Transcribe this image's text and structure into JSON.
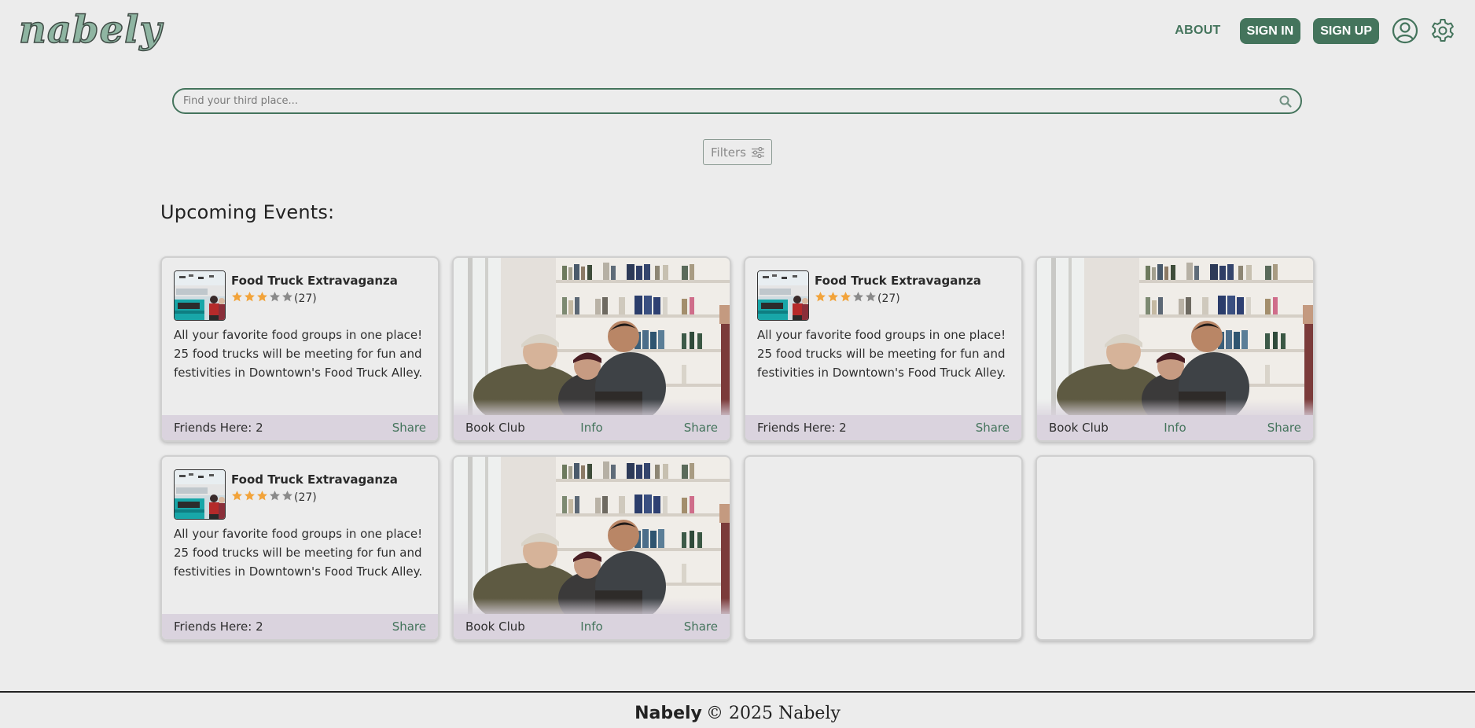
{
  "header": {
    "logo_text": "nabely",
    "about_label": "ABOUT",
    "sign_in_label": "SIGN IN",
    "sign_up_label": "SIGN UP",
    "profile_icon": "user-circle-icon",
    "settings_icon": "gear-icon"
  },
  "search": {
    "placeholder": "Find your third place...",
    "value": "",
    "icon": "search-icon"
  },
  "filters": {
    "label": "Filters",
    "icon": "sliders-icon"
  },
  "events": {
    "heading": "Upcoming Events:",
    "cards": [
      {
        "type": "event",
        "title": "Food Truck Extravaganza",
        "rating": 3,
        "max_rating": 5,
        "review_count": "(27)",
        "description": "All your favorite food groups in one place! 25 food trucks will be meeting for fun and festivities in Downtown's Food Truck Alley.",
        "friends_label": "Friends Here: 2",
        "share_label": "Share"
      },
      {
        "type": "photo",
        "name": "Book Club",
        "info_label": "Info",
        "share_label": "Share"
      },
      {
        "type": "event",
        "title": "Food Truck Extravaganza",
        "rating": 3,
        "max_rating": 5,
        "review_count": "(27)",
        "description": "All your favorite food groups in one place! 25 food trucks will be meeting for fun and festivities in Downtown's Food Truck Alley.",
        "friends_label": "Friends Here: 2",
        "share_label": "Share"
      },
      {
        "type": "photo",
        "name": "Book Club",
        "info_label": "Info",
        "share_label": "Share"
      },
      {
        "type": "event",
        "title": "Food Truck Extravaganza",
        "rating": 3,
        "max_rating": 5,
        "review_count": "(27)",
        "description": "All your favorite food groups in one place! 25 food trucks will be meeting for fun and festivities in Downtown's Food Truck Alley.",
        "friends_label": "Friends Here: 2",
        "share_label": "Share"
      },
      {
        "type": "photo",
        "name": "Book Club",
        "info_label": "Info",
        "share_label": "Share"
      },
      {
        "type": "empty"
      },
      {
        "type": "empty"
      }
    ]
  },
  "footer": {
    "brand": "Nabely",
    "copyright": "© 2025 Nabely"
  },
  "colors": {
    "accent": "#44745c",
    "background": "#ececec",
    "star_filled": "#f2a33a",
    "star_empty": "#8a8a8a",
    "card_footer": "#dad3de"
  }
}
